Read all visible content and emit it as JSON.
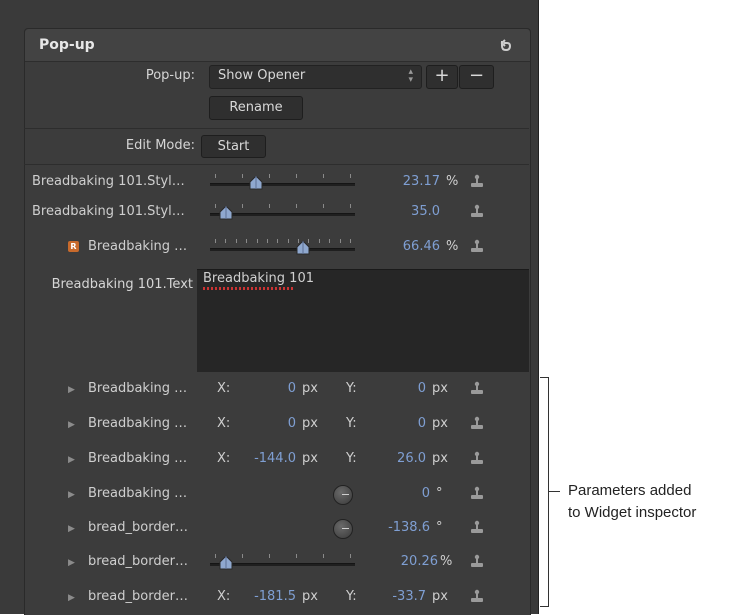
{
  "header": {
    "title": "Pop-up"
  },
  "popup_row": {
    "label": "Pop-up:",
    "value": "Show Opener",
    "add_label": "+",
    "remove_label": "−",
    "rename_label": "Rename"
  },
  "edit_mode": {
    "label": "Edit Mode:",
    "button_label": "Start"
  },
  "rows": [
    {
      "label": "Breadbaking 101.Styl…",
      "value": "23.17",
      "unit": "%",
      "level": 0.3
    },
    {
      "label": "Breadbaking 101.Styl…",
      "value": "35.0",
      "unit": "",
      "level": 0.07
    },
    {
      "label": "Breadbaking …",
      "badge": "R",
      "value": "66.46",
      "unit": "%",
      "level": 0.66
    }
  ],
  "text_row": {
    "label": "Breadbaking 101.Text",
    "value": "Breadbaking 101"
  },
  "params": [
    {
      "label": "Breadbaking …",
      "x_label": "X:",
      "x_value": "0",
      "x_unit": "px",
      "y_label": "Y:",
      "y_value": "0",
      "y_unit": "px"
    },
    {
      "label": "Breadbaking …",
      "x_label": "X:",
      "x_value": "0",
      "x_unit": "px",
      "y_label": "Y:",
      "y_value": "0",
      "y_unit": "px"
    },
    {
      "label": "Breadbaking …",
      "x_label": "X:",
      "x_value": "-144.0",
      "x_unit": "px",
      "y_label": "Y:",
      "y_value": "26.0",
      "y_unit": "px"
    },
    {
      "label": "Breadbaking …",
      "value": "0",
      "unit": "°"
    },
    {
      "label": "bread_border…",
      "value": "-138.6",
      "unit": "°"
    },
    {
      "label": "bread_border…",
      "value": "20.26",
      "unit": "%",
      "level": 0.07
    },
    {
      "label": "bread_border…",
      "x_label": "X:",
      "x_value": "-181.5",
      "x_unit": "px",
      "y_label": "Y:",
      "y_value": "-33.7",
      "y_unit": "px"
    }
  ],
  "annotation": {
    "line1": "Parameters added",
    "line2": "to Widget inspector"
  },
  "icons": {
    "reset": "reset-arrow-icon",
    "rig": "rig-joystick-icon",
    "disclosure": "disclosure-triangle-icon"
  }
}
